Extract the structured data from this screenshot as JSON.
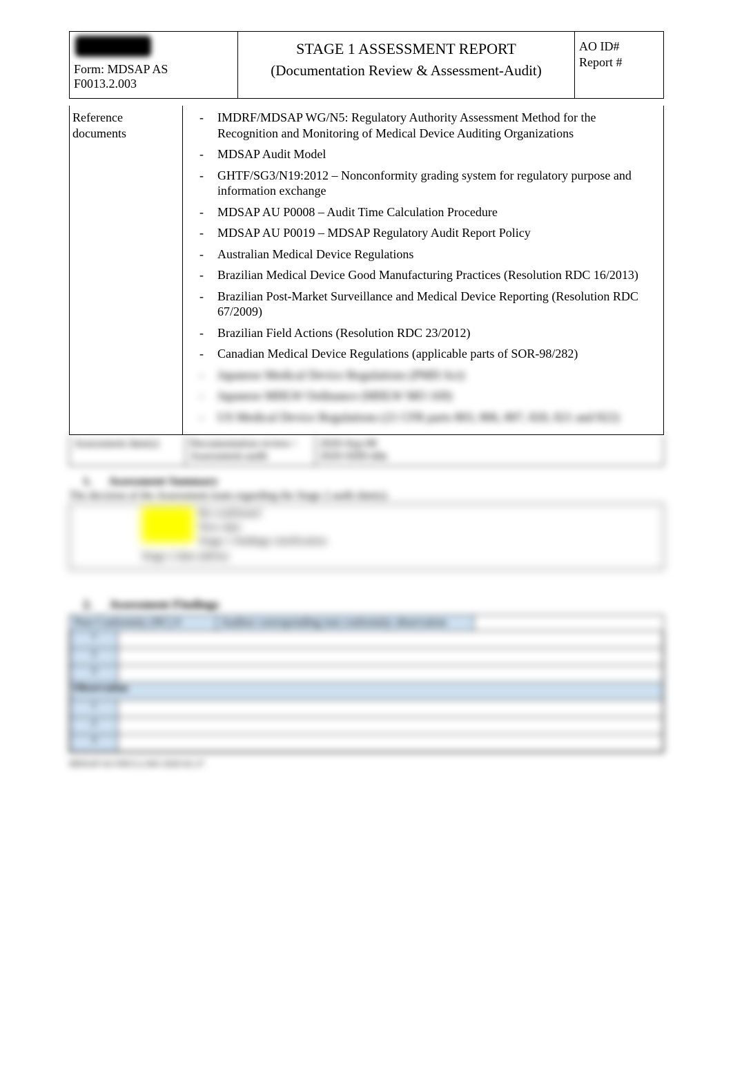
{
  "header": {
    "form_id": "Form: MDSAP AS F0013.2.003",
    "title_line1": "STAGE 1 ASSESSMENT REPORT",
    "title_line2": "(Documentation Review & Assessment-Audit)",
    "ao_id_label": "AO ID#",
    "report_no_label": "Report #"
  },
  "reference": {
    "label": "Reference documents",
    "items": [
      "IMDRF/MDSAP WG/N5: Regulatory Authority Assessment Method for the Recognition and Monitoring of Medical Device Auditing Organizations",
      "MDSAP Audit Model",
      "GHTF/SG3/N19:2012 – Nonconformity grading system for regulatory purpose and information exchange",
      "MDSAP AU P0008 – Audit Time Calculation Procedure",
      "MDSAP AU P0019 – MDSAP Regulatory Audit Report Policy",
      "Australian Medical Device Regulations",
      "Brazilian Medical Device Good Manufacturing Practices (Resolution RDC 16/2013)",
      "Brazilian Post-Market Surveillance and Medical Device Reporting (Resolution RDC 67/2009)",
      "Brazilian Field Actions (Resolution RDC 23/2012)",
      "Canadian Medical Device Regulations (applicable parts of SOR-98/282)",
      "Japanese Medical Device Regulations (PMD Act)",
      "Japanese MHLW Ordinance (MHLW MO 169)",
      "US Medical Device Regulations (21 CFR parts 803, 806, 807, 820, 821 and 822)"
    ]
  },
  "meta": {
    "c1": "Assessment date(s)",
    "c2": "Documentation review / Assessment-audit",
    "c3a": "2020-Sep-08",
    "c3b": "2020-SDD-dda"
  },
  "section1": {
    "num": "1.",
    "title": "Assessment Summary",
    "caption": "The decision of the Assessment team regarding the Stage 2 audit date(s)",
    "opt1": "Re-confirmed",
    "opt2": "New date",
    "opt3": "Stage 1 findings clarification",
    "opt4": "Stage 2 date (dd/m)"
  },
  "section2": {
    "num": "2.",
    "title": "Assessment Findings",
    "col1": "Non Conformity (NC) #",
    "col2": "Auditor corresponding non conformity observation",
    "obs_label": "Observation",
    "rows1": [
      "1",
      "2",
      "3"
    ],
    "rows2": [
      "1",
      "2",
      "3"
    ]
  },
  "footer": "MDSAP AS F0013.2.003 2020-02-27"
}
